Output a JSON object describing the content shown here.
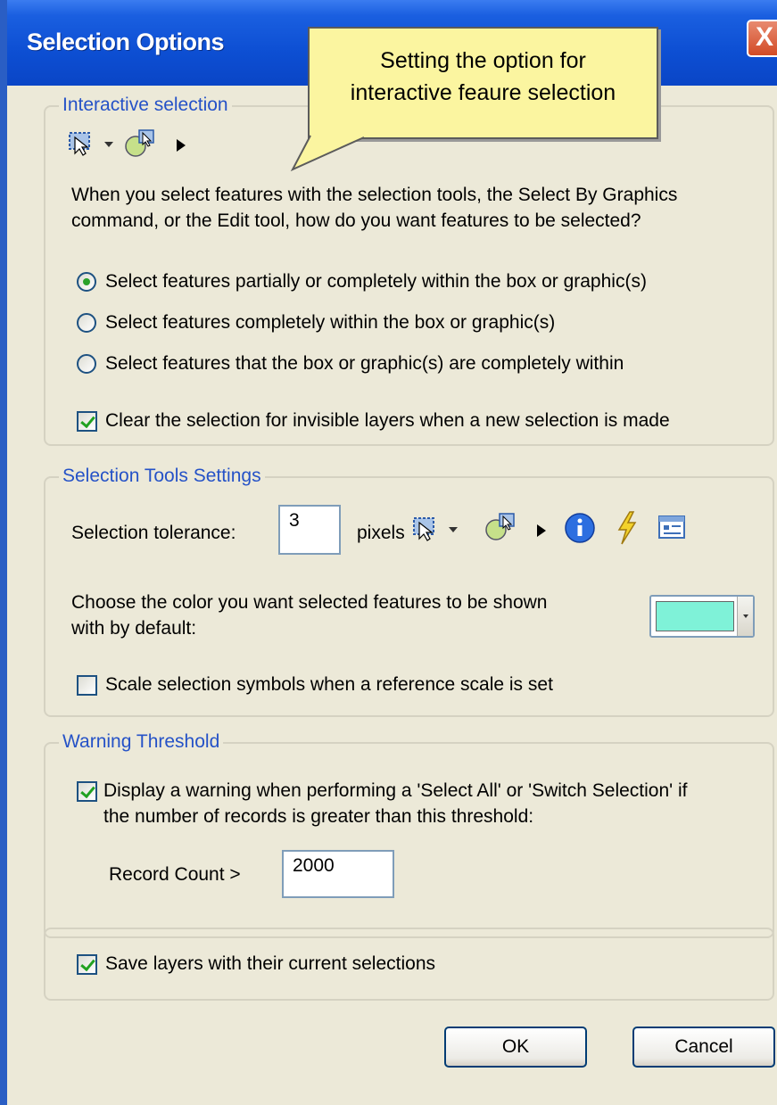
{
  "window": {
    "title": "Selection Options",
    "close_label": "X"
  },
  "callout": {
    "line1": "Setting the option for",
    "line2": "interactive feaure selection"
  },
  "interactive": {
    "legend": "Interactive selection",
    "question": "When you select features with the selection tools, the Select By Graphics command, or the Edit tool, how do you want features to be selected?",
    "options": [
      {
        "label": "Select features partially or completely within the box or graphic(s)",
        "selected": true
      },
      {
        "label": "Select features completely within the box or graphic(s)",
        "selected": false
      },
      {
        "label": "Select features that the box or graphic(s) are completely within",
        "selected": false
      }
    ],
    "clear_invisible": {
      "label": "Clear the selection for invisible layers when a new selection is made",
      "checked": true
    },
    "icons": [
      "select-by-rectangle-icon",
      "select-by-graphics-icon",
      "edit-arrow-icon"
    ]
  },
  "tools": {
    "legend": "Selection Tools Settings",
    "tolerance_label": "Selection tolerance:",
    "tolerance_value": "3",
    "tolerance_unit": "pixels",
    "icons": [
      "select-by-rectangle-icon",
      "select-by-graphics-icon",
      "edit-arrow-icon",
      "identify-icon",
      "hyperlink-icon",
      "html-popup-icon"
    ],
    "color_label_line1": "Choose the color you want selected features to be shown",
    "color_label_line2": "with by default:",
    "selection_color": "#7ff2d8",
    "scale_symbols": {
      "label": "Scale selection symbols when a reference scale is set",
      "checked": false
    }
  },
  "warning": {
    "legend": "Warning Threshold",
    "display_warning_line1": "Display a warning when performing a 'Select All' or 'Switch Selection' if",
    "display_warning_line2": "the number of records is greater than this threshold:",
    "checked": true,
    "record_count_label": "Record Count >",
    "record_count_value": "2000"
  },
  "save_layers": {
    "label": "Save layers with their current selections",
    "checked": true
  },
  "buttons": {
    "ok": "OK",
    "cancel": "Cancel"
  }
}
